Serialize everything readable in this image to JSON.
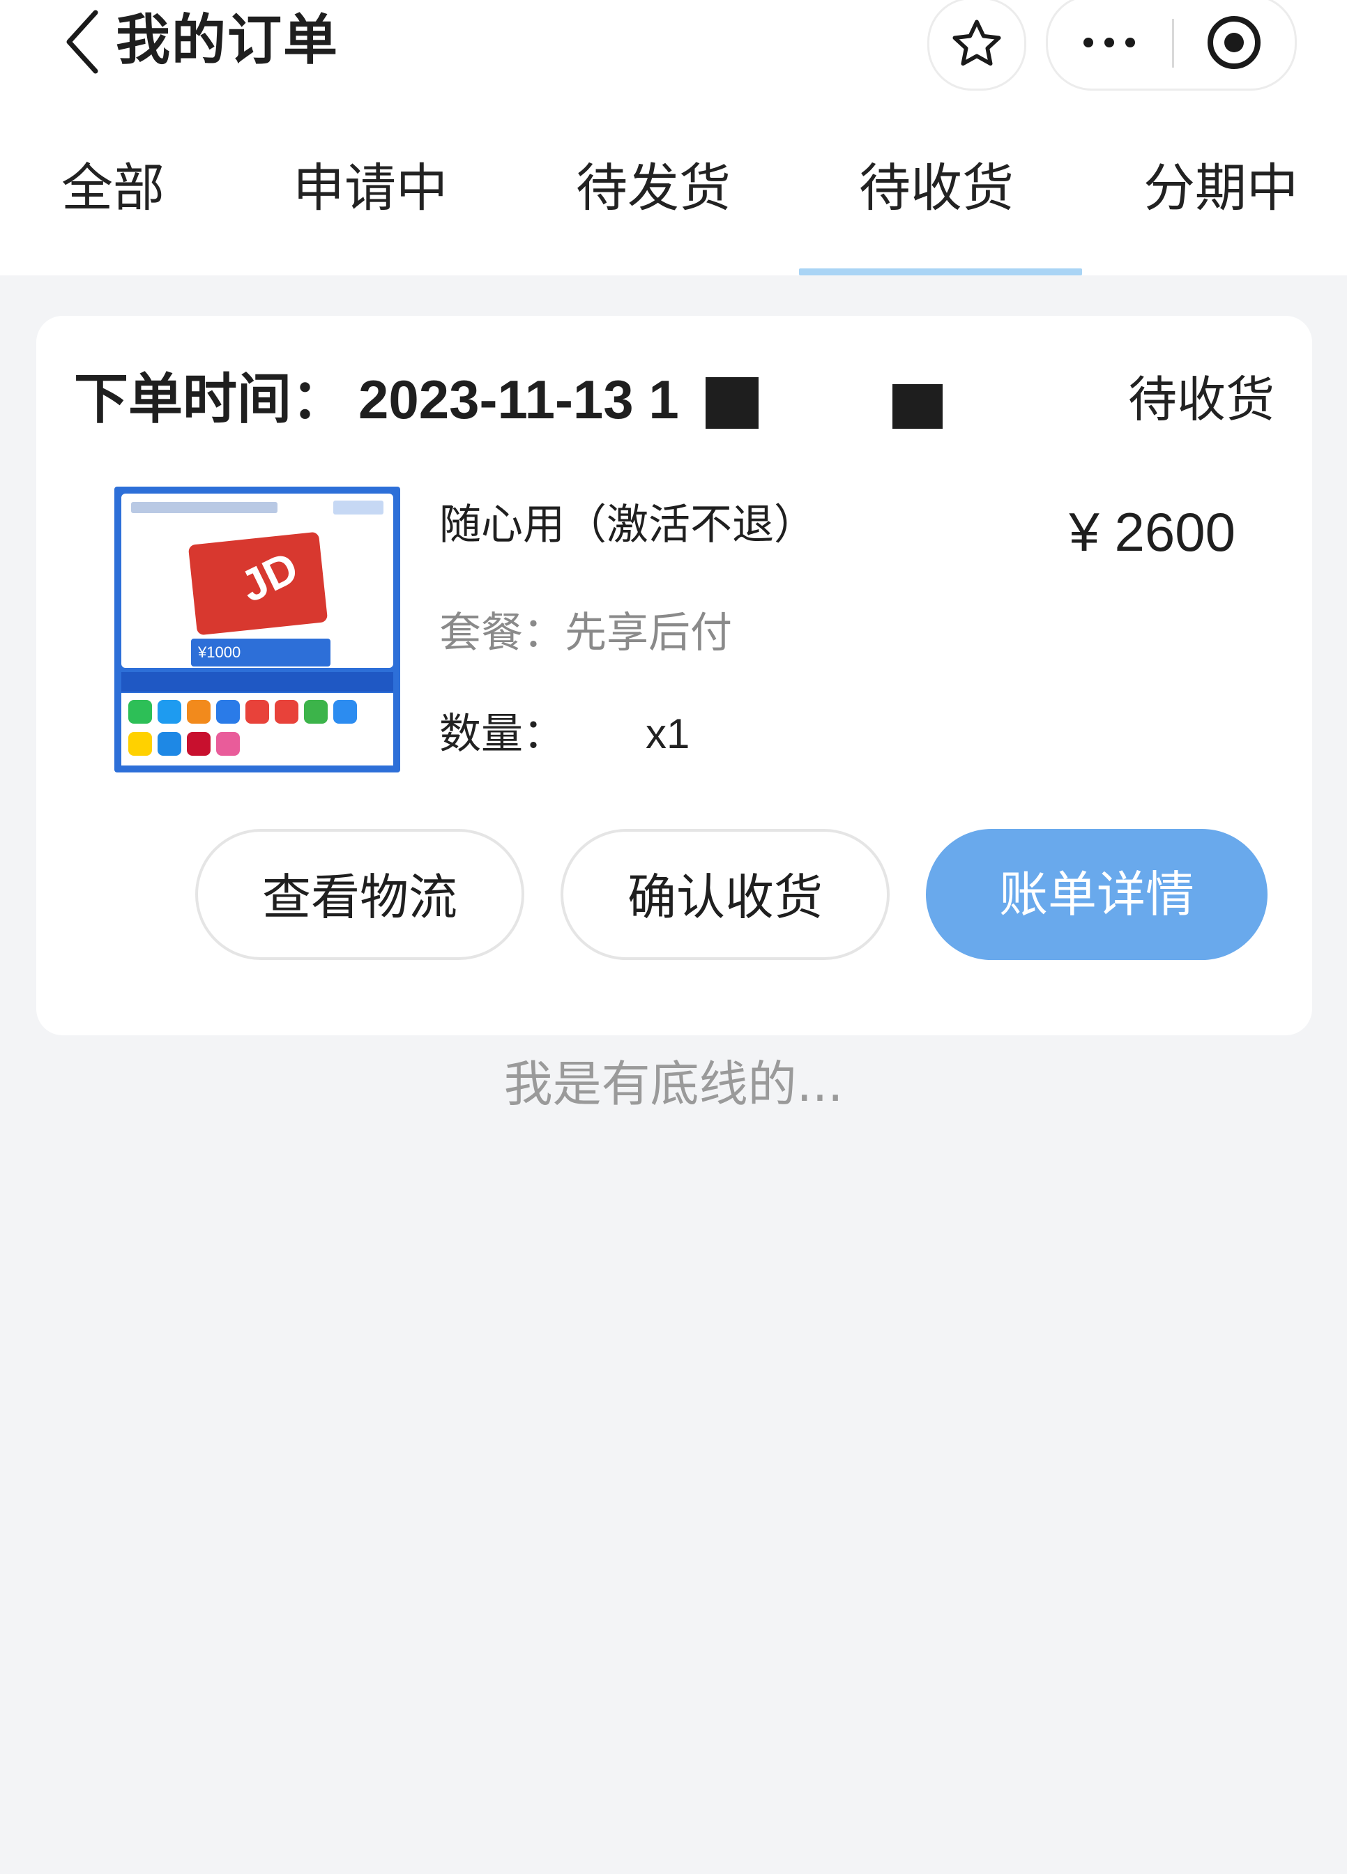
{
  "nav": {
    "title": "我的订单",
    "icons": [
      "chevron-left-icon",
      "star-icon",
      "more-icon",
      "close-target-icon"
    ]
  },
  "tabs": [
    {
      "label": "全部",
      "active": false
    },
    {
      "label": "申请中",
      "active": false
    },
    {
      "label": "待发货",
      "active": false
    },
    {
      "label": "待收货",
      "active": true
    },
    {
      "label": "分期中",
      "active": false
    }
  ],
  "order": {
    "time_label": "下单时间：",
    "time_value": "2023-11-13 1",
    "status": "待收货",
    "product_name": "随心用（激活不退）",
    "price": "¥ 2600",
    "package_label": "套餐：",
    "package_value": "先享后付",
    "quantity_label": "数量：",
    "quantity_value": "x1",
    "image_caption": "¥1000"
  },
  "actions": {
    "logistics": "查看物流",
    "confirm": "确认收货",
    "bill": "账单详情"
  },
  "footer": "我是有底线的...",
  "colors": {
    "tab_indicator": "#a9d4f5",
    "primary_button": "#69a9ec",
    "background": "#f3f4f6"
  }
}
